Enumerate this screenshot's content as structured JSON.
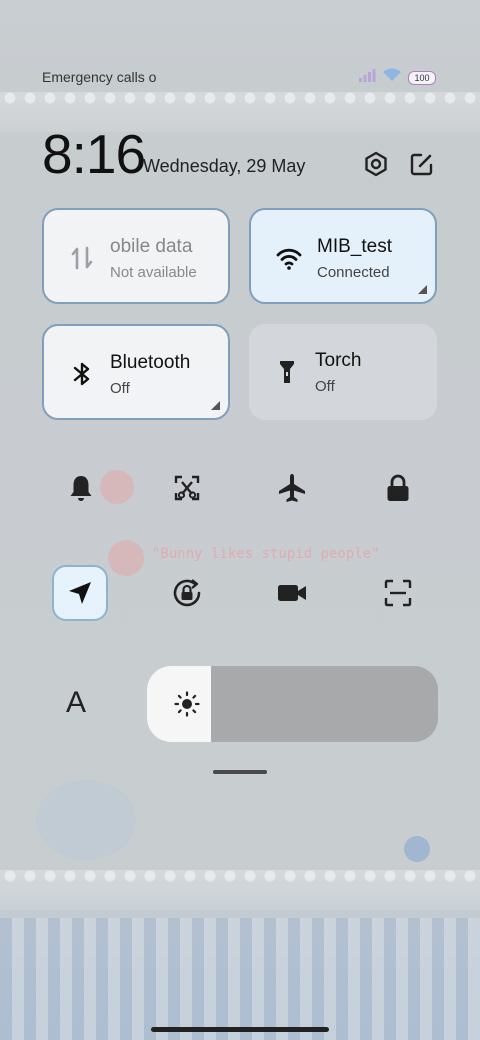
{
  "status_bar": {
    "left_text": "Emergency calls o",
    "battery_text": "100",
    "signal_icon": "signal-icon",
    "wifi_icon": "wifi-icon"
  },
  "header": {
    "time": "8:16",
    "date": "Wednesday, 29 May",
    "settings_icon": "gear-icon",
    "edit_icon": "edit-icon"
  },
  "tiles": [
    {
      "title": "obile data",
      "subtitle": "Not available",
      "icon": "mobile-data-icon"
    },
    {
      "title": "MIB_test",
      "subtitle": "Connected",
      "icon": "wifi-icon"
    },
    {
      "title": "Bluetooth",
      "subtitle": "Off",
      "icon": "bluetooth-icon"
    },
    {
      "title": "Torch",
      "subtitle": "Off",
      "icon": "torch-icon"
    }
  ],
  "toggles": [
    {
      "name": "bell-icon",
      "on": false
    },
    {
      "name": "screenshot-icon",
      "on": false
    },
    {
      "name": "airplane-icon",
      "on": false
    },
    {
      "name": "lock-icon",
      "on": false
    },
    {
      "name": "location-icon",
      "on": true
    },
    {
      "name": "rotation-lock-icon",
      "on": false
    },
    {
      "name": "screen-recorder-icon",
      "on": false
    },
    {
      "name": "scanner-icon",
      "on": false
    }
  ],
  "brightness": {
    "label": "A",
    "level": 0.22,
    "icon": "sun-icon"
  },
  "wallpaper_text": "\"Bunny likes stupid people\"",
  "colors": {
    "tile_border": "#7f9fbd",
    "active_tile": "#e4f1fb",
    "slider_fill": "#f6f6f6"
  }
}
